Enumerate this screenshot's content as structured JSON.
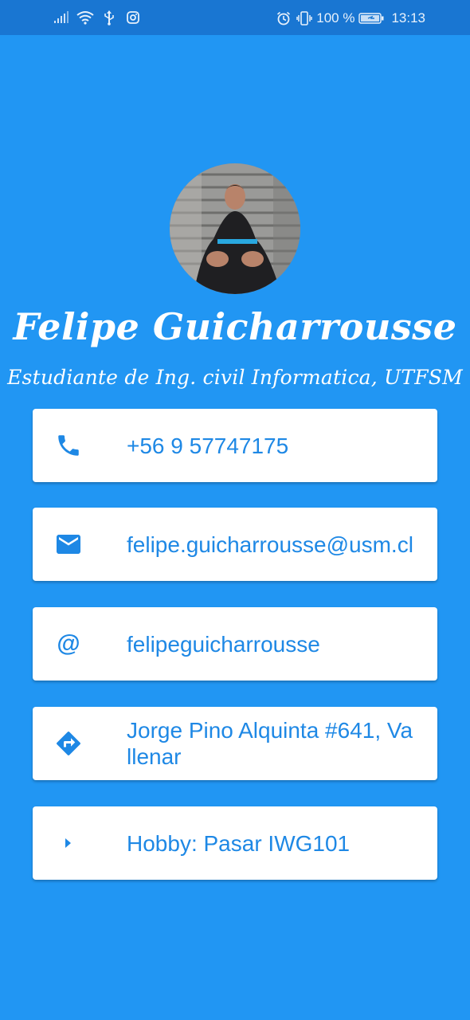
{
  "status_bar": {
    "battery_percent": "100 %",
    "time": "13:13",
    "icons": [
      "signal-icon",
      "wifi-icon",
      "usb-icon",
      "instagram-icon",
      "alarm-icon",
      "vibrate-icon",
      "battery-icon"
    ]
  },
  "profile": {
    "name": "Felipe Guicharrousse",
    "subtitle": "Estudiante de Ing. civil Informatica, UTFSM"
  },
  "cards": [
    {
      "icon": "phone-icon",
      "text": "+56 9 57747175"
    },
    {
      "icon": "email-icon",
      "text": "felipe.guicharrousse@usm.cl"
    },
    {
      "icon": "at-icon",
      "icon_glyph": "@",
      "text": "felipeguicharrousse"
    },
    {
      "icon": "directions-icon",
      "text": "Jorge Pino Alquinta #641, Vallenar"
    },
    {
      "icon": "arrow-right-icon",
      "text": "Hobby: Pasar IWG101"
    }
  ],
  "colors": {
    "background": "#2196F3",
    "status_bar": "#1976D2",
    "accent": "#1E88E5",
    "card": "#FFFFFF"
  }
}
